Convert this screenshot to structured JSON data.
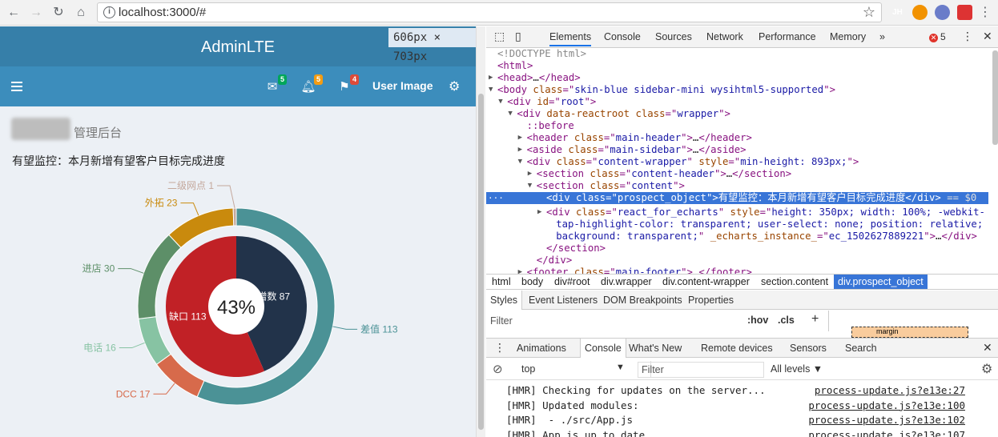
{
  "browser": {
    "url": "localhost:3000/#",
    "ext_icons": [
      {
        "name": "jh-extension-icon",
        "label": "JH",
        "color": "#4a7fe0"
      },
      {
        "name": "redux-extension-icon",
        "label": "",
        "color": "#f29200"
      },
      {
        "name": "blue-extension-icon",
        "label": "",
        "color": "#6a7cc9"
      },
      {
        "name": "red-extension-icon",
        "label": "",
        "color": "#d33"
      }
    ]
  },
  "app": {
    "logo": "AdminLTE",
    "size_tooltip": "606px × 703px",
    "badges": {
      "mail": "5",
      "bell": "5",
      "flag": "4"
    },
    "user": "User Image",
    "page_title": "管理后台",
    "prospect_title": "有望监控：本月新增有望客户目标完成进度",
    "chart_data": {
      "type": "pie",
      "center_label": "43%",
      "inner": [
        {
          "name": "新增数",
          "value": 87,
          "color": "#22334a"
        },
        {
          "name": "缺口",
          "value": 113,
          "color": "#c12126"
        }
      ],
      "outer": [
        {
          "name": "差值",
          "value": 113,
          "color": "#4b9296"
        },
        {
          "name": "DCC",
          "value": 17,
          "color": "#d76a4b"
        },
        {
          "name": "电话",
          "value": 16,
          "color": "#87c3a3"
        },
        {
          "name": "进店",
          "value": 30,
          "color": "#5d8f68"
        },
        {
          "name": "外拓",
          "value": 23,
          "color": "#c98a0d"
        },
        {
          "name": "二级网点",
          "value": 1,
          "color": "#c4a89c"
        }
      ]
    }
  },
  "devtools": {
    "tabs": [
      "Elements",
      "Console",
      "Sources",
      "Network",
      "Performance",
      "Memory"
    ],
    "more": "»",
    "errors": "5",
    "dom": [
      {
        "i": 0,
        "parts": [
          [
            "cm",
            "<!DOCTYPE html>"
          ]
        ]
      },
      {
        "i": 0,
        "parts": [
          [
            "tg",
            "<html>"
          ]
        ]
      },
      {
        "i": 0,
        "ar": "▶",
        "parts": [
          [
            "tg",
            "<head>"
          ],
          [
            "tx",
            "…"
          ],
          [
            "tg",
            "</head>"
          ]
        ]
      },
      {
        "i": 0,
        "ar": "▼",
        "parts": [
          [
            "tg",
            "<body "
          ],
          [
            "an",
            "class"
          ],
          [
            "tg",
            "=\""
          ],
          [
            "av",
            "skin-blue sidebar-mini wysihtml5-supported"
          ],
          [
            "tg",
            "\">"
          ]
        ]
      },
      {
        "i": 1,
        "ar": "▼",
        "parts": [
          [
            "tg",
            "<div "
          ],
          [
            "an",
            "id"
          ],
          [
            "tg",
            "=\""
          ],
          [
            "av",
            "root"
          ],
          [
            "tg",
            "\">"
          ]
        ]
      },
      {
        "i": 2,
        "ar": "▼",
        "parts": [
          [
            "tg",
            "<div "
          ],
          [
            "an",
            "data-reactroot class"
          ],
          [
            "tg",
            "=\""
          ],
          [
            "av",
            "wrapper"
          ],
          [
            "tg",
            "\">"
          ]
        ]
      },
      {
        "i": 3,
        "parts": [
          [
            "tg",
            "::before"
          ]
        ]
      },
      {
        "i": 3,
        "ar": "▶",
        "parts": [
          [
            "tg",
            "<header "
          ],
          [
            "an",
            "class"
          ],
          [
            "tg",
            "=\""
          ],
          [
            "av",
            "main-header"
          ],
          [
            "tg",
            "\">"
          ],
          [
            "tx",
            "…"
          ],
          [
            "tg",
            "</header>"
          ]
        ]
      },
      {
        "i": 3,
        "ar": "▶",
        "parts": [
          [
            "tg",
            "<aside "
          ],
          [
            "an",
            "class"
          ],
          [
            "tg",
            "=\""
          ],
          [
            "av",
            "main-sidebar"
          ],
          [
            "tg",
            "\">"
          ],
          [
            "tx",
            "…"
          ],
          [
            "tg",
            "</aside>"
          ]
        ]
      },
      {
        "i": 3,
        "ar": "▼",
        "parts": [
          [
            "tg",
            "<div "
          ],
          [
            "an",
            "class"
          ],
          [
            "tg",
            "=\""
          ],
          [
            "av",
            "content-wrapper"
          ],
          [
            "tg",
            "\" "
          ],
          [
            "an",
            "style"
          ],
          [
            "tg",
            "=\""
          ],
          [
            "av",
            "min-height: 893px;"
          ],
          [
            "tg",
            "\">"
          ]
        ]
      },
      {
        "i": 4,
        "ar": "▶",
        "parts": [
          [
            "tg",
            "<section "
          ],
          [
            "an",
            "class"
          ],
          [
            "tg",
            "=\""
          ],
          [
            "av",
            "content-header"
          ],
          [
            "tg",
            "\">"
          ],
          [
            "tx",
            "…"
          ],
          [
            "tg",
            "</section>"
          ]
        ]
      },
      {
        "i": 4,
        "ar": "▼",
        "parts": [
          [
            "tg",
            "<section "
          ],
          [
            "an",
            "class"
          ],
          [
            "tg",
            "=\""
          ],
          [
            "av",
            "content"
          ],
          [
            "tg",
            "\">"
          ]
        ]
      },
      {
        "i": 5,
        "sel": true,
        "parts": [
          [
            "tg",
            "<div "
          ],
          [
            "an",
            "class"
          ],
          [
            "tg",
            "=\""
          ],
          [
            "av",
            "prospect_object"
          ],
          [
            "tg",
            "\">"
          ],
          [
            "tx",
            "有望监控：本月新增有望客户目标完成进度"
          ],
          [
            "tg",
            "</div>"
          ],
          [
            "tx",
            " == $0"
          ]
        ]
      },
      {
        "i": 5,
        "ar": "▶",
        "parts": [
          [
            "tg",
            "<div "
          ],
          [
            "an",
            "class"
          ],
          [
            "tg",
            "=\""
          ],
          [
            "av",
            "react_for_echarts"
          ],
          [
            "tg",
            "\" "
          ],
          [
            "an",
            "style"
          ],
          [
            "tg",
            "=\""
          ],
          [
            "av",
            "height: 350px; width: 100%; -webkit-"
          ]
        ]
      },
      {
        "i": 6,
        "parts": [
          [
            "av",
            "tap-highlight-color: transparent; user-select: none; position: relative;"
          ]
        ]
      },
      {
        "i": 6,
        "parts": [
          [
            "av",
            "background: transparent;"
          ],
          [
            "tg",
            "\" "
          ],
          [
            "an",
            "_echarts_instance_"
          ],
          [
            "tg",
            "=\""
          ],
          [
            "av",
            "ec_1502627889221"
          ],
          [
            "tg",
            "\">"
          ],
          [
            "tx",
            "…"
          ],
          [
            "tg",
            "</div>"
          ]
        ]
      },
      {
        "i": 5,
        "parts": [
          [
            "tg",
            "</section>"
          ]
        ]
      },
      {
        "i": 4,
        "parts": [
          [
            "tg",
            "</div>"
          ]
        ]
      },
      {
        "i": 3,
        "ar": "▶",
        "parts": [
          [
            "tg",
            "<footer "
          ],
          [
            "an",
            "class"
          ],
          [
            "tg",
            "=\""
          ],
          [
            "av",
            "main-footer"
          ],
          [
            "tg",
            "\">"
          ],
          [
            "tx",
            "…"
          ],
          [
            "tg",
            "</footer>"
          ]
        ]
      }
    ],
    "breadcrumbs": [
      "html",
      "body",
      "div#root",
      "div.wrapper",
      "div.content-wrapper",
      "section.content",
      "div.prospect_object"
    ],
    "style_tabs": [
      "Styles",
      "Event Listeners",
      "DOM Breakpoints",
      "Properties"
    ],
    "filter_placeholder": "Filter",
    "hov": ":hov",
    "cls": ".cls",
    "plus": "+",
    "box_label": "margin",
    "drawer_tabs": [
      "Animations",
      "Console",
      "What's New",
      "Remote devices",
      "Sensors",
      "Search"
    ],
    "context": "top",
    "console_filter": "Filter",
    "levels": "All levels",
    "logs": [
      {
        "msg": "[HMR] Checking for updates on the server...",
        "src": "process-update.js?e13e:27"
      },
      {
        "msg": "[HMR] Updated modules:",
        "src": "process-update.js?e13e:100"
      },
      {
        "msg": "[HMR]  - ./src/App.js",
        "src": "process-update.js?e13e:102"
      },
      {
        "msg": "[HMR] App is up to date.",
        "src": "process-update.js?e13e:107"
      }
    ]
  }
}
